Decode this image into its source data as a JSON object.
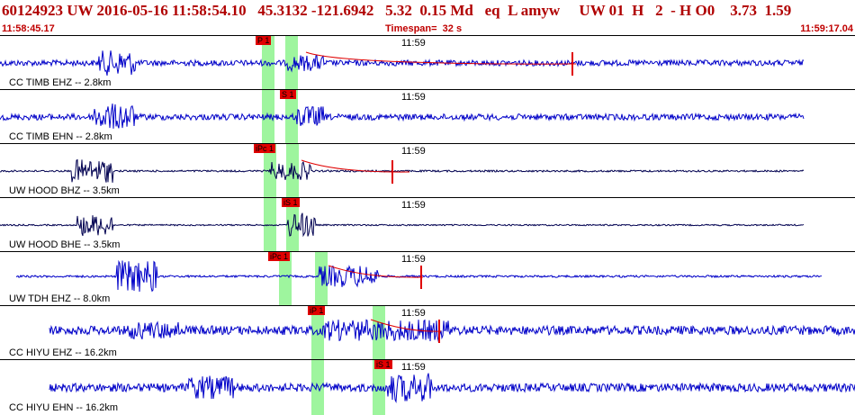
{
  "header": {
    "title": "60124923 UW 2016-05-16 11:58:54.10   45.3132 -121.6942   5.32  0.15 Md   eq  L amyw     UW 01  H   2  - H O0    3.73  1.59",
    "start_time": "11:58:45.17",
    "timespan": "Timespan=  32 s",
    "end_time": "11:59:17.04"
  },
  "colors": {
    "trace": "#0000c8",
    "trace_dark": "#000050",
    "pick": "#e00000",
    "highlight": "#9ef59e",
    "text": "#000000",
    "header_text": "#b00000"
  },
  "panels": [
    {
      "label": "CC TIMB EHZ -- 2.8km",
      "minute": "11:59",
      "pick": "P 1"
    },
    {
      "label": "CC TIMB EHN -- 2.8km",
      "minute": "11:59",
      "pick": "S 1"
    },
    {
      "label": "UW HOOD BHZ -- 3.5km",
      "minute": "11:59",
      "pick": "iPc 1"
    },
    {
      "label": "UW HOOD BHE -- 3.5km",
      "minute": "11:59",
      "pick": "iS 1"
    },
    {
      "label": "UW TDH EHZ -- 8.0km",
      "minute": "11:59",
      "pick": "iPc 1"
    },
    {
      "label": "CC HIYU EHZ -- 16.2km",
      "minute": "11:59",
      "pick": "iP 1"
    },
    {
      "label": "CC HIYU EHN -- 16.2km",
      "minute": "11:59",
      "pick": "iS 1"
    }
  ]
}
